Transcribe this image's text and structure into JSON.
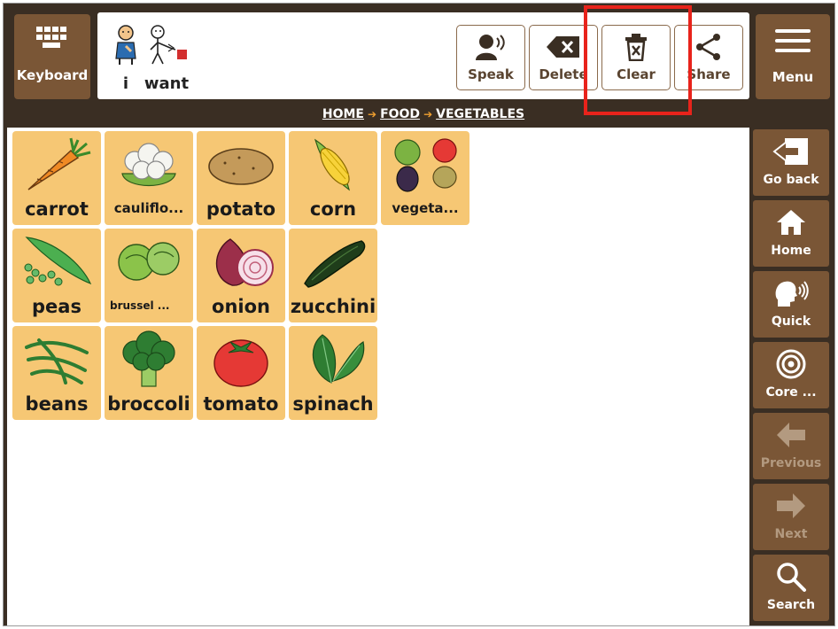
{
  "topbar": {
    "keyboard_label": "Keyboard",
    "menu_label": "Menu",
    "message": [
      {
        "label": "i"
      },
      {
        "label": "want"
      }
    ],
    "actions": {
      "speak": "Speak",
      "delete": "Delete",
      "clear": "Clear",
      "share": "Share"
    }
  },
  "breadcrumb": [
    "HOME",
    "FOOD",
    "VEGETABLES"
  ],
  "tiles": [
    {
      "label": "carrot",
      "icon": "carrot"
    },
    {
      "label": "cauliflo...",
      "icon": "cauliflower"
    },
    {
      "label": "potato",
      "icon": "potato"
    },
    {
      "label": "corn",
      "icon": "corn"
    },
    {
      "label": "vegeta...",
      "icon": "vegetables"
    },
    {
      "label": "peas",
      "icon": "peas"
    },
    {
      "label": "brussel ...",
      "icon": "brussels-sprouts"
    },
    {
      "label": "onion",
      "icon": "onion"
    },
    {
      "label": "zucchini",
      "icon": "zucchini"
    },
    {
      "label": "beans",
      "icon": "beans"
    },
    {
      "label": "broccoli",
      "icon": "broccoli"
    },
    {
      "label": "tomato",
      "icon": "tomato"
    },
    {
      "label": "spinach",
      "icon": "spinach"
    }
  ],
  "sidebar": {
    "go_back": "Go back",
    "home": "Home",
    "quick": "Quick",
    "core": "Core ...",
    "previous": "Previous",
    "next": "Next",
    "search": "Search"
  },
  "colors": {
    "frame": "#3a2e23",
    "button_brown": "#7a5636",
    "tile": "#f6c774",
    "highlight": "#e8231b"
  }
}
